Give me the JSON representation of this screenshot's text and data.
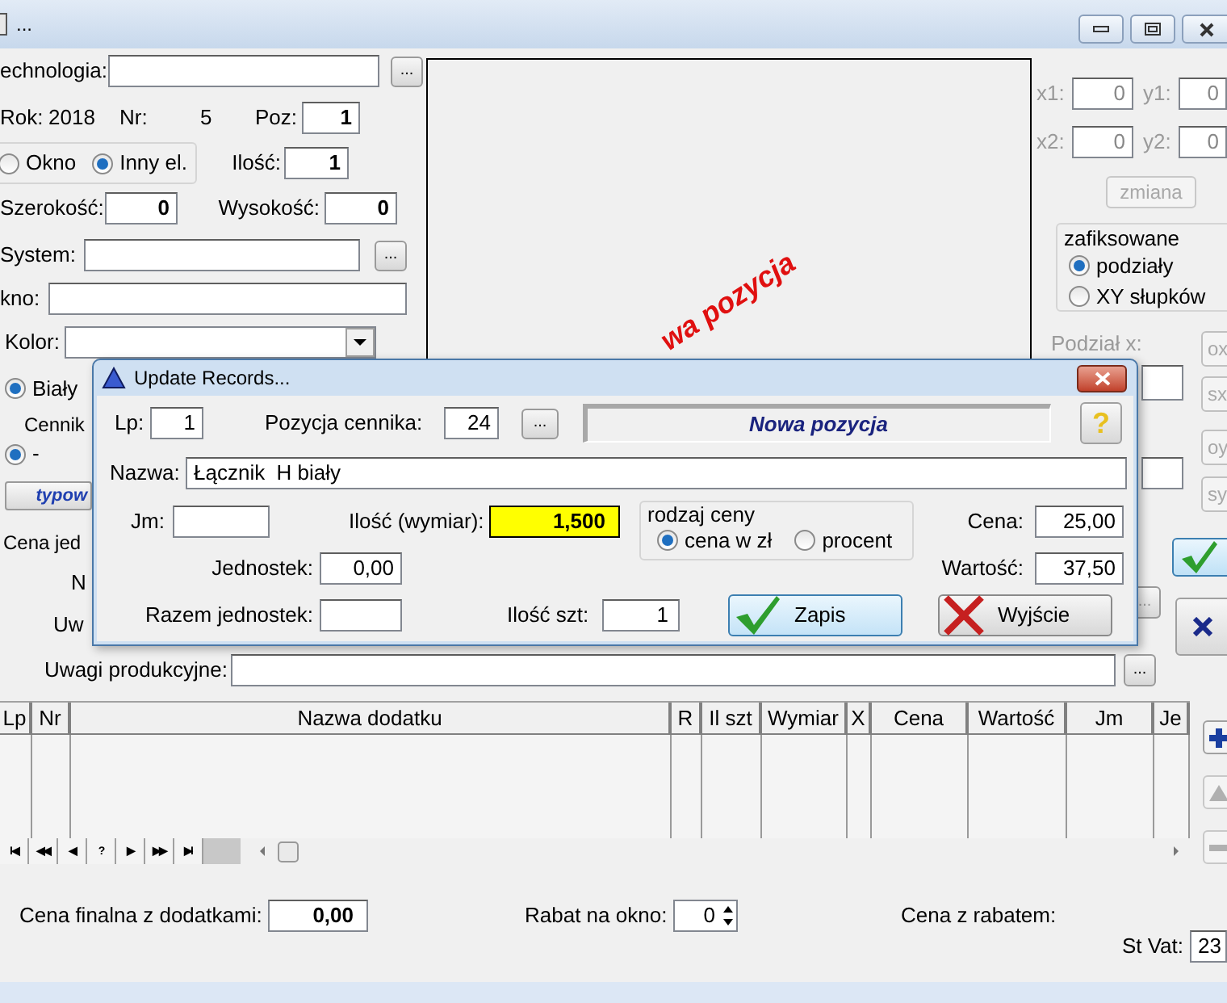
{
  "window": {
    "title": "..."
  },
  "main": {
    "technologia": {
      "label": "echnologia:",
      "button": "..."
    },
    "rok": {
      "label": "Rok:",
      "value": "2018"
    },
    "nr": {
      "label": "Nr:",
      "value": "5"
    },
    "poz": {
      "label": "Poz:",
      "value": "1"
    },
    "element_type": [
      {
        "label": "Okno",
        "selected": false
      },
      {
        "label": "Inny el.",
        "selected": true
      }
    ],
    "ilosc": {
      "label": "Ilość:",
      "value": "1"
    },
    "szerokosc": {
      "label": "Szerokość:",
      "value": "0"
    },
    "wysokosc": {
      "label": "Wysokość:",
      "value": "0"
    },
    "system": {
      "label": "System:",
      "button": "..."
    },
    "okno": {
      "label": "kno:"
    },
    "kolor": {
      "label": "Kolor:"
    },
    "color_options": [
      {
        "label": "Biały",
        "selected": true
      }
    ],
    "cennik_label": "Cennik",
    "price_options": [
      {
        "label": "-",
        "selected": true
      }
    ],
    "typ_button": "typow",
    "partial_labels": [
      "Cena jed",
      "N",
      "Uw"
    ],
    "preview_text": "wa pozycja",
    "coords": [
      {
        "label": "x1:",
        "value": "0"
      },
      {
        "label": "y1:",
        "value": "0"
      },
      {
        "label": "x2:",
        "value": "0"
      },
      {
        "label": "y2:",
        "value": "0"
      }
    ],
    "zmiana_button": {
      "label": "zmiana",
      "disabled": true
    },
    "fixed_group": {
      "title": "zafiksowane",
      "options": [
        {
          "label": "podziały",
          "selected": true
        },
        {
          "label": "XY słupków",
          "selected": false
        }
      ]
    },
    "podzial_label": "Podział x:",
    "side_buttons": [
      "ox",
      "sx",
      "oy",
      "sy"
    ],
    "uw_button": "...",
    "uwagi": {
      "label": "Uwagi produkcyjne:",
      "button": "..."
    }
  },
  "grid": {
    "columns": [
      "Lp",
      "Nr",
      "Nazwa dodatku",
      "R",
      "Il szt",
      "Wymiar",
      "X",
      "Cena",
      "Wartość",
      "Jm",
      "Je"
    ],
    "nav_buttons": [
      "I◀",
      "◀◀",
      "◀",
      "?",
      "▶",
      "▶▶",
      "▶I"
    ]
  },
  "totals": {
    "cena_finalna": {
      "label": "Cena finalna z dodatkami:",
      "value": "0,00"
    },
    "rabat": {
      "label": "Rabat na okno:",
      "value": "0"
    },
    "cena_z_rabatem": {
      "label": "Cena z rabatem:"
    },
    "st_vat": {
      "label": "St Vat:",
      "value": "23"
    }
  },
  "dialog": {
    "title": "Update Records...",
    "lp": {
      "label": "Lp:",
      "value": "1"
    },
    "pozycja": {
      "label": "Pozycja cennika:",
      "value": "24",
      "button": "..."
    },
    "status": "Nowa pozycja",
    "help_button": "?",
    "nazwa": {
      "label": "Nazwa:",
      "value": "Łącznik  H biały"
    },
    "jm": {
      "label": "Jm:"
    },
    "ilosc": {
      "label": "Ilość (wymiar):",
      "value": "1,500",
      "highlighted": true
    },
    "price_type": {
      "title": "rodzaj ceny",
      "options": [
        {
          "label": "cena w zł",
          "selected": true
        },
        {
          "label": "procent",
          "selected": false
        }
      ]
    },
    "cena": {
      "label": "Cena:",
      "value": "25,00"
    },
    "jednostek": {
      "label": "Jednostek:",
      "value": "0,00"
    },
    "wartosc": {
      "label": "Wartość:",
      "value": "37,50"
    },
    "razem": {
      "label": "Razem jednostek:"
    },
    "ilosc_szt": {
      "label": "Ilość szt:",
      "value": "1"
    },
    "buttons": [
      {
        "label": "Zapis",
        "kind": "save"
      },
      {
        "label": "Wyjście",
        "kind": "exit"
      }
    ]
  }
}
